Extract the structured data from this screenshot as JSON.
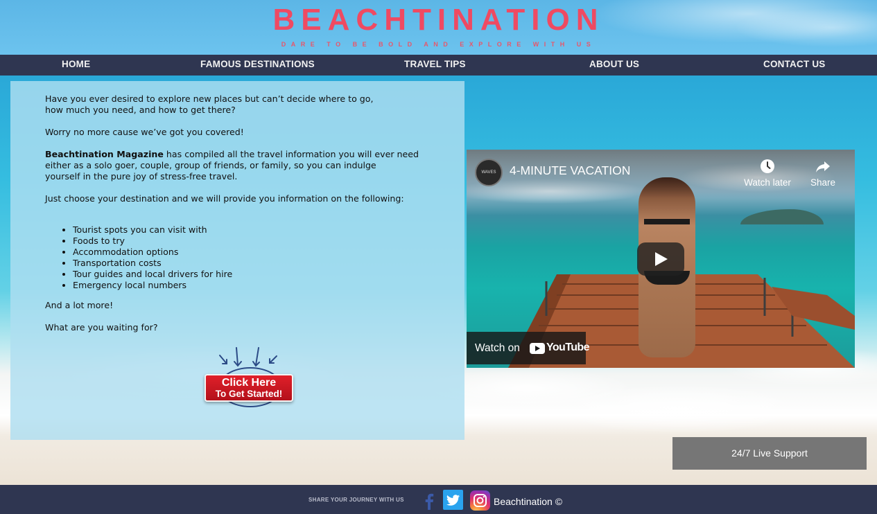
{
  "header": {
    "logo": "BEACHTINATION",
    "tagline": "DARE TO BE BOLD AND EXPLORE WITH US"
  },
  "nav": {
    "items": [
      {
        "label": "HOME"
      },
      {
        "label": "FAMOUS DESTINATIONS"
      },
      {
        "label": "TRAVEL TIPS"
      },
      {
        "label": "ABOUT US"
      },
      {
        "label": "CONTACT US"
      }
    ]
  },
  "intro": {
    "p1_line1": "Have you ever desired to explore new places but can’t decide where to go,",
    "p1_line2": "how much you need, and how to get there?",
    "p2": "Worry no more cause we’ve got you covered!",
    "p3_bold": "Beachtination Magazine",
    "p3_line1_rest": " has compiled all the travel information you will ever need",
    "p3_line2": "either as a solo goer, couple, group of friends, or family, so you can indulge",
    "p3_line3": "yourself in the pure joy of stress-free travel.",
    "p4": "Just choose your destination and we will provide you information on the following:",
    "list": [
      "Tourist spots you can visit with",
      "Foods to try",
      "Accommodation options",
      "Transportation costs",
      "Tour guides and local drivers for hire",
      "Emergency local numbers"
    ],
    "p5": "And a lot more!",
    "p6": "What are you waiting for?"
  },
  "cta": {
    "line1": "Click Here",
    "line2": "To Get Started!"
  },
  "video": {
    "title": "4-MINUTE VACATION",
    "channel_avatar_text": "WAVES",
    "watch_later": "Watch later",
    "share": "Share",
    "watch_on": "Watch on",
    "youtube": "YouTube"
  },
  "support": {
    "label": "24/7 Live Support"
  },
  "footer": {
    "share_text": "SHARE YOUR JOURNEY WITH US",
    "brand": "Beachtination ©"
  },
  "colors": {
    "logo": "#ef4a62",
    "nav_bg": "#2f3651",
    "support_bg": "#767676",
    "twitter": "#2aa3ee"
  },
  "icons": [
    "clock-icon",
    "share-icon",
    "play-icon",
    "youtube-logo-icon",
    "facebook-icon",
    "twitter-icon",
    "instagram-icon",
    "arrows-icon"
  ]
}
